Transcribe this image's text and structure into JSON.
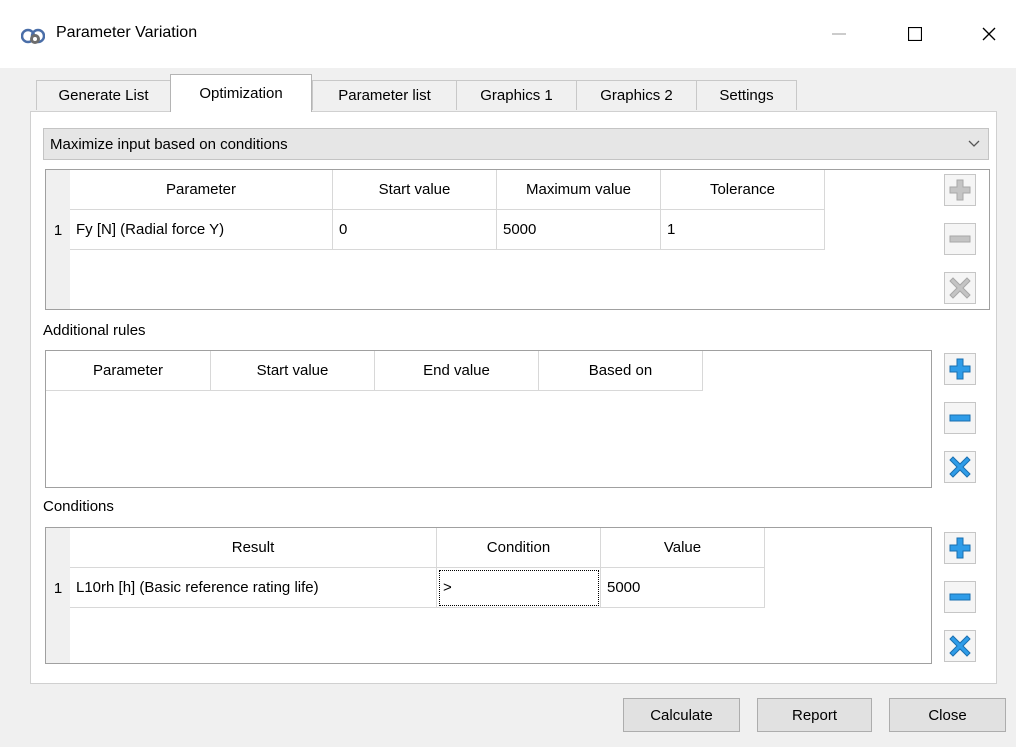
{
  "window": {
    "title": "Parameter Variation"
  },
  "tabs": [
    {
      "label": "Generate List"
    },
    {
      "label": "Optimization"
    },
    {
      "label": "Parameter list"
    },
    {
      "label": "Graphics 1"
    },
    {
      "label": "Graphics 2"
    },
    {
      "label": "Settings"
    }
  ],
  "mode_select": {
    "value": "Maximize input based on conditions"
  },
  "optimization_table": {
    "headers": [
      "Parameter",
      "Start value",
      "Maximum value",
      "Tolerance"
    ],
    "rows": [
      {
        "num": "1",
        "cells": [
          "Fy [N]  (Radial force Y)",
          "0",
          "5000",
          "1"
        ]
      }
    ]
  },
  "additional_rules": {
    "label": "Additional rules",
    "headers": [
      "Parameter",
      "Start value",
      "End value",
      "Based on"
    ]
  },
  "conditions": {
    "label": "Conditions",
    "headers": [
      "Result",
      "Condition",
      "Value"
    ],
    "rows": [
      {
        "num": "1",
        "cells": [
          "L10rh [h]  (Basic reference rating life)",
          ">",
          "5000"
        ]
      }
    ]
  },
  "buttons": {
    "calculate": "Calculate",
    "report": "Report",
    "close": "Close"
  },
  "colors": {
    "icon_active": "#1e90e0",
    "icon_disabled": "#bdbdbd"
  }
}
